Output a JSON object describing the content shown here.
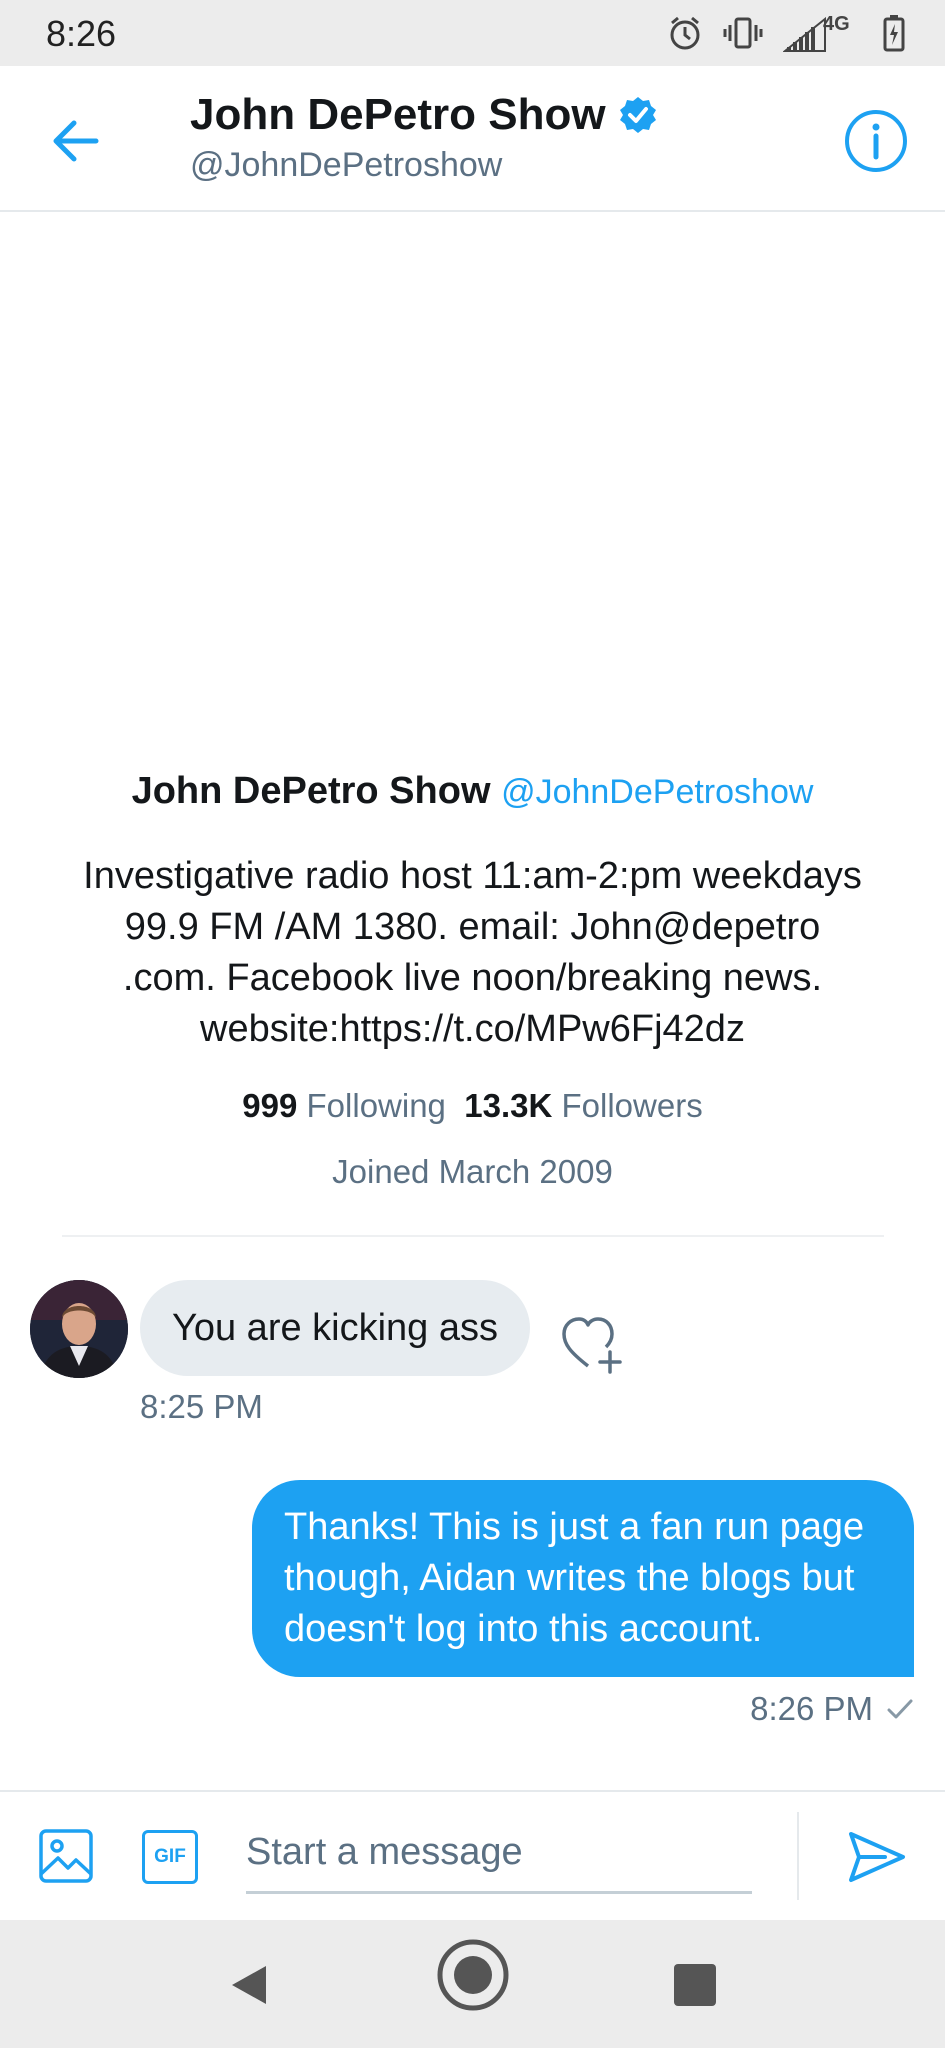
{
  "status_bar": {
    "time": "8:26",
    "network": "4G"
  },
  "header": {
    "name": "John DePetro Show",
    "handle": "@JohnDePetroshow"
  },
  "profile": {
    "name": "John DePetro Show",
    "handle": "@JohnDePetroshow",
    "bio_lines": [
      "Investigative radio host 11:am-2:pm weekdays",
      "99.9 FM /AM 1380. email: John@depetro",
      ".com. Facebook live noon/breaking news.",
      "website:https://t.co/MPw6Fj42dz"
    ],
    "following_count": "999",
    "following_label": "Following",
    "followers_count": "13.3K",
    "followers_label": "Followers",
    "joined": "Joined March 2009"
  },
  "messages": {
    "incoming": {
      "text": "You are kicking ass",
      "time": "8:25 PM"
    },
    "outgoing": {
      "lines": [
        "Thanks! This is just a fan run page",
        "though, Aidan writes the blogs but",
        "doesn't log into this account."
      ],
      "time": "8:26 PM"
    }
  },
  "composer": {
    "gif_label": "GIF",
    "placeholder": "Start a message"
  },
  "colors": {
    "accent": "#1da1f2",
    "muted": "#5b7083",
    "text": "#14171a"
  }
}
